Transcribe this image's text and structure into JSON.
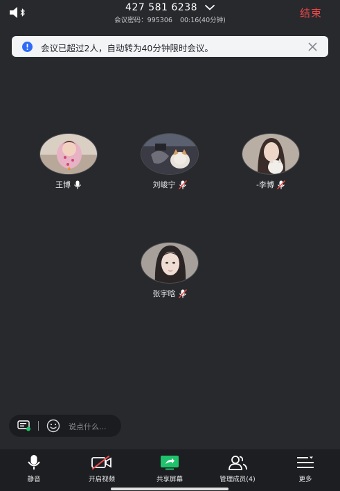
{
  "header": {
    "meeting_id": "427 581 6238",
    "password_label": "会议密码：995306",
    "timer": "00:16(40分钟)",
    "end_label": "结束"
  },
  "banner": {
    "text": "会议已超过2人，自动转为40分钟限时会议。"
  },
  "participants": [
    {
      "name": "王博",
      "mic": "on"
    },
    {
      "name": "刘峻宁",
      "mic": "muted"
    },
    {
      "name": "-李博",
      "mic": "muted"
    },
    {
      "name": "张宇晗",
      "mic": "muted"
    }
  ],
  "chat": {
    "placeholder": "说点什么..."
  },
  "toolbar": {
    "items": [
      {
        "label": "静音",
        "icon": "microphone-icon"
      },
      {
        "label": "开启视频",
        "icon": "video-off-icon"
      },
      {
        "label": "共享屏幕",
        "icon": "share-screen-icon"
      },
      {
        "label": "管理成员(4)",
        "icon": "members-icon"
      },
      {
        "label": "更多",
        "icon": "more-menu-icon"
      }
    ]
  },
  "colors": {
    "background": "#27292d",
    "end": "#f04848",
    "info": "#2f6cf6",
    "share": "#1ec36b"
  }
}
